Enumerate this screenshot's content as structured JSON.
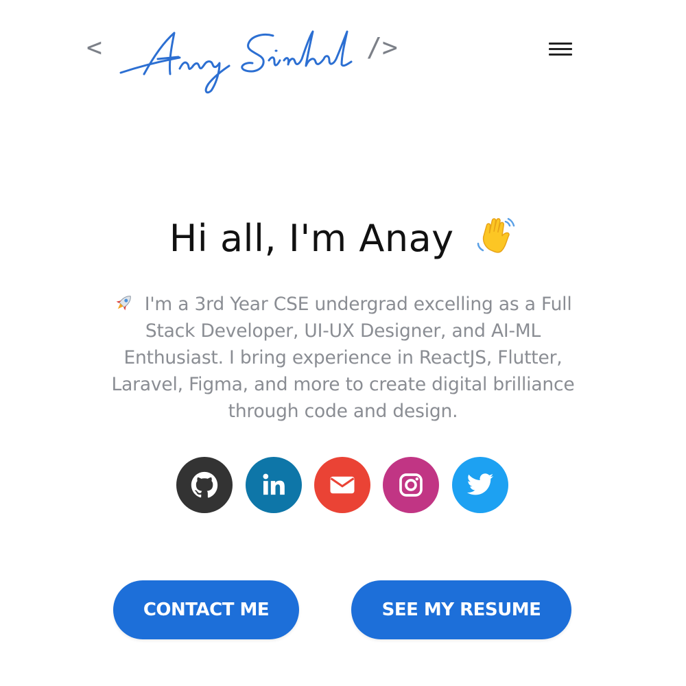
{
  "header": {
    "logo_open": "<",
    "logo_name": "Anay Sinhal",
    "logo_close": "/>",
    "menu_icon": "hamburger-menu-icon"
  },
  "greeting": {
    "title": "Hi all, I'm Anay",
    "emoji": "waving-hand-icon"
  },
  "subtitle": {
    "emoji": "rocket-icon",
    "text": "I'm a 3rd Year CSE undergrad excelling as a Full Stack Developer, UI-UX Designer, and AI-ML Enthusiast. I bring experience in ReactJS, Flutter, Laravel, Figma, and more to create digital brilliance through code and design."
  },
  "social": [
    {
      "name": "github",
      "icon": "github-icon",
      "color": "#333333"
    },
    {
      "name": "linkedin",
      "icon": "linkedin-icon",
      "color": "#0e76a8"
    },
    {
      "name": "email",
      "icon": "mail-icon",
      "color": "#ea4335"
    },
    {
      "name": "instagram",
      "icon": "instagram-icon",
      "color": "#c13584"
    },
    {
      "name": "twitter",
      "icon": "twitter-icon",
      "color": "#1da1f2"
    }
  ],
  "buttons": {
    "contact_label": "CONTACT ME",
    "resume_label": "SEE MY RESUME"
  },
  "colors": {
    "accent": "#1d6fd9",
    "logo_script": "#2c6fd2",
    "subtitle_text": "#8a8d93"
  }
}
